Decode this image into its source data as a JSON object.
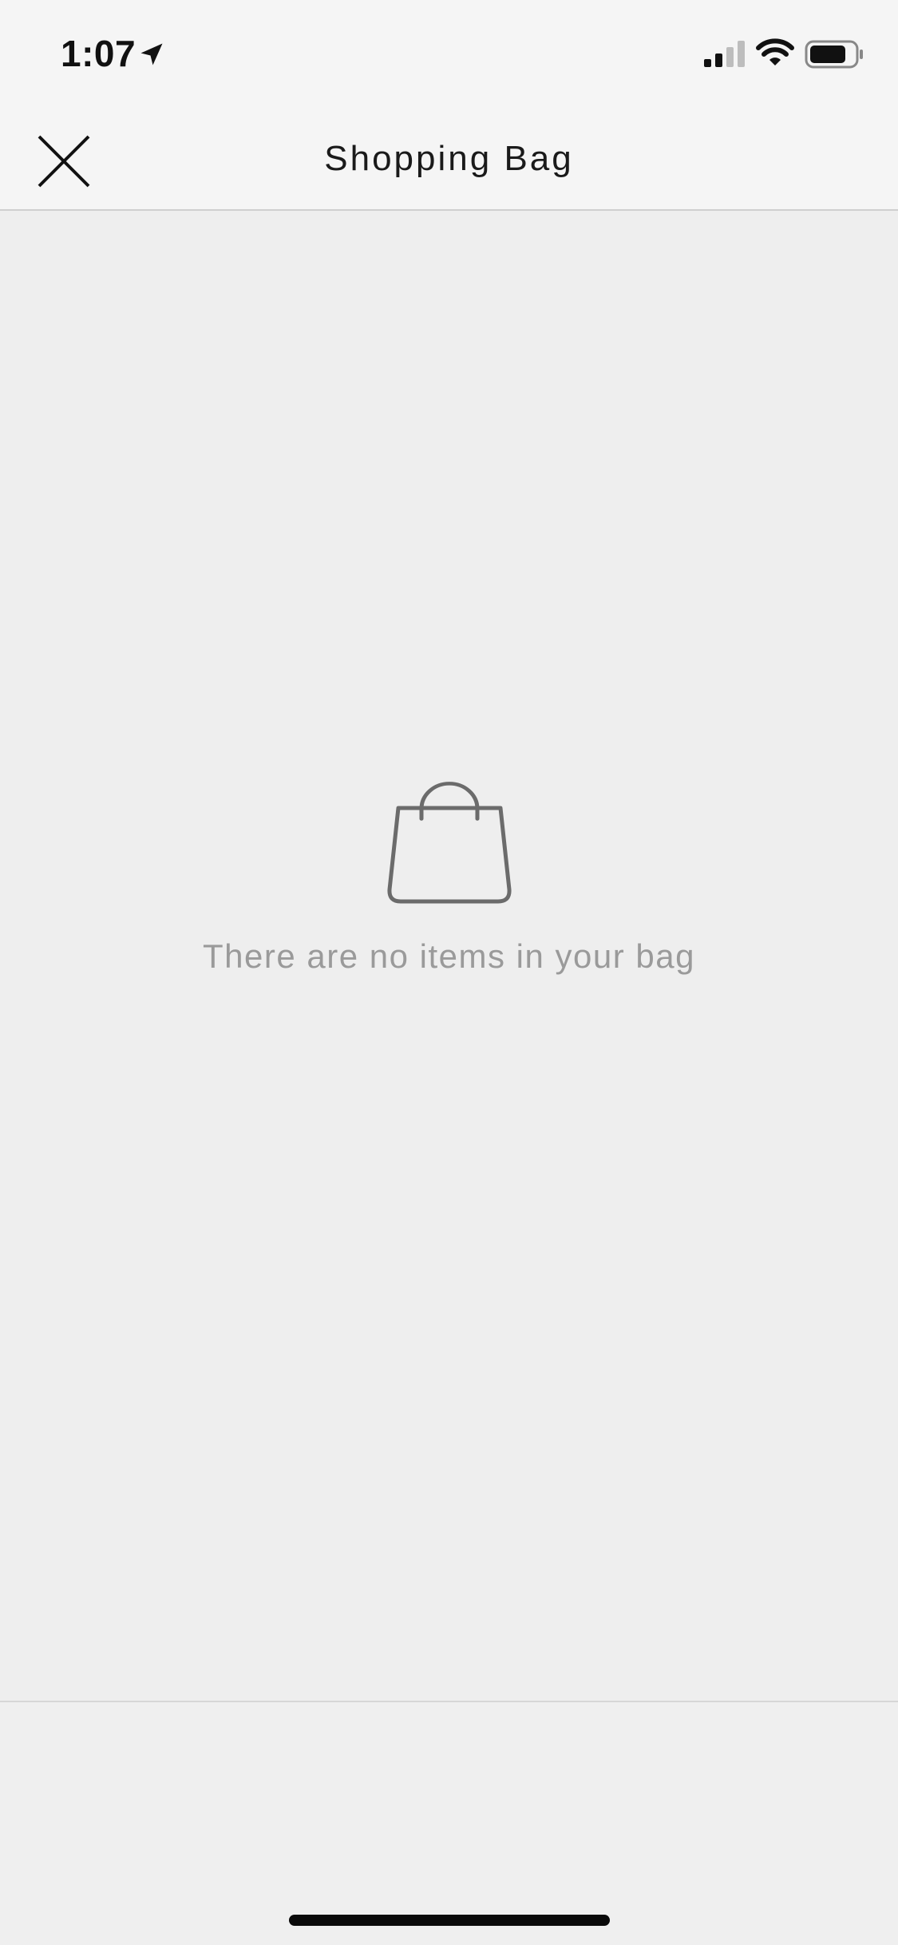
{
  "status_bar": {
    "time": "1:07",
    "location_icon": "location-arrow-icon",
    "signal_icon": "cellular-signal-icon",
    "wifi_icon": "wifi-icon",
    "battery_icon": "battery-icon"
  },
  "nav": {
    "title": "Shopping Bag",
    "close_icon": "close-icon"
  },
  "empty_state": {
    "icon": "shopping-bag-icon",
    "message": "There are no items in your bag"
  },
  "colors": {
    "background": "#eeeeee",
    "header_background": "#f5f5f5",
    "title_text": "#1a1a1a",
    "empty_text": "#9a9a9a",
    "bag_icon_stroke": "#6b6b6b"
  }
}
